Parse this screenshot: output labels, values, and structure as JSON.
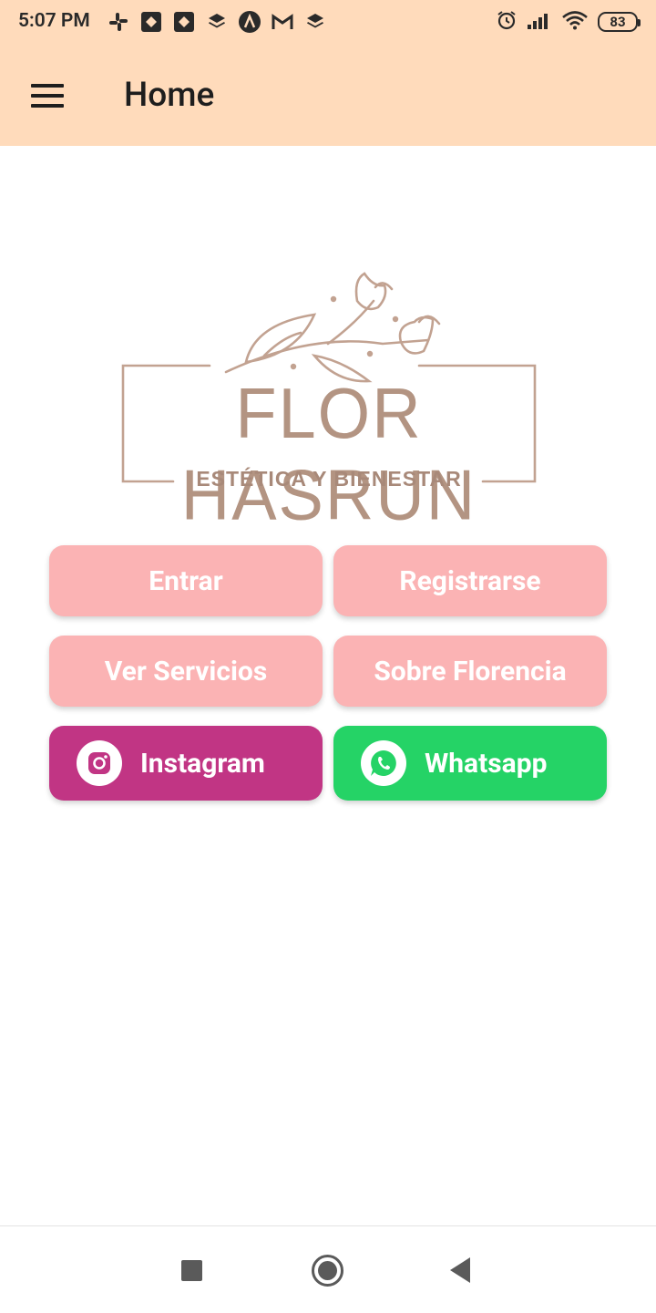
{
  "status_bar": {
    "time": "5:07 PM",
    "notification_icons": [
      "slack-icon",
      "jira-icon",
      "jira-icon",
      "layers-icon",
      "app-a-icon",
      "gmail-icon",
      "layers-icon"
    ],
    "battery": "83"
  },
  "app_bar": {
    "title": "Home",
    "menu_icon": "hamburger-menu-icon",
    "background": "#ffdbbb"
  },
  "logo": {
    "brand": "FLOR HASRUN",
    "tagline": "ESTÉTICA Y BIENESTAR",
    "color": "#b39482"
  },
  "buttons": {
    "entrar": "Entrar",
    "registrarse": "Registrarse",
    "ver_servicios": "Ver Servicios",
    "sobre_florencia": "Sobre Florencia",
    "instagram": "Instagram",
    "whatsapp": "Whatsapp"
  },
  "colors": {
    "pink_button": "#fbb3b4",
    "instagram": "#c13584",
    "whatsapp": "#25d366"
  },
  "nav_bar": {
    "recent_icon": "square-recent-apps-icon",
    "home_icon": "circle-home-icon",
    "back_icon": "triangle-back-icon"
  }
}
